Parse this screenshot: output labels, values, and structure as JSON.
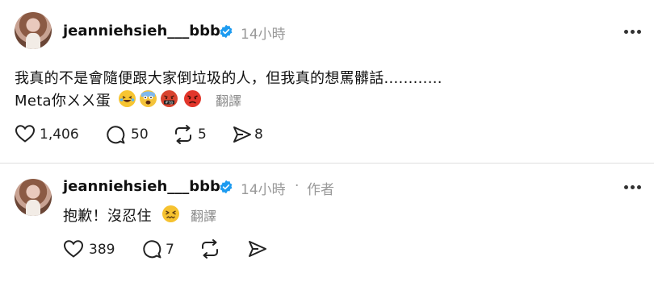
{
  "post": {
    "username": "jeanniehsieh___bbb",
    "time": "14小時",
    "line1": "我真的不是會隨便跟大家倒垃圾的人，但我真的想罵髒話............",
    "line2": "Meta你ㄨㄨ蛋",
    "translate": "翻譯",
    "likes": "1,406",
    "comments": "50",
    "reposts": "5",
    "shares": "8"
  },
  "reply": {
    "username": "jeanniehsieh___bbb",
    "time": "14小時",
    "separator": "·",
    "author_tag": "作者",
    "text": "抱歉！沒忍住",
    "translate": "翻譯",
    "likes": "389",
    "comments": "7"
  },
  "icons": {
    "post_emojis": [
      "grinning-squinting-tears-emoji",
      "shocked-face-emoji",
      "cursing-face-emoji",
      "angry-face-emoji"
    ],
    "reply_emojis": [
      "confounded-face-emoji"
    ],
    "verified_color": "#1d9bf0"
  }
}
